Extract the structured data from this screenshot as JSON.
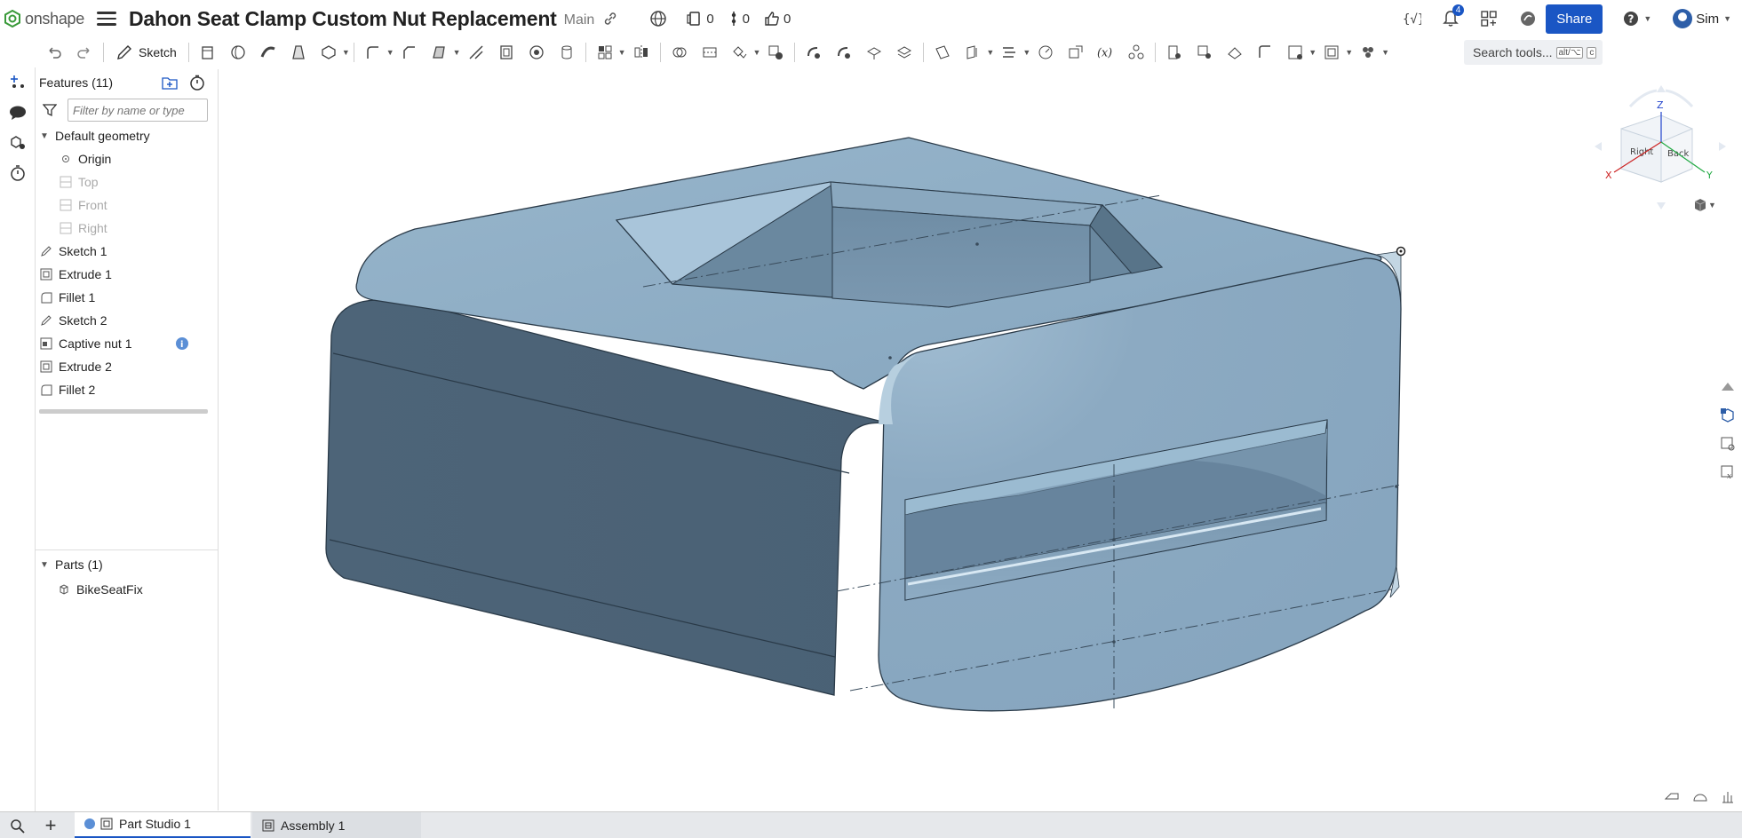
{
  "header": {
    "logo_text": "onshape",
    "doc_title": "Dahon Seat Clamp Custom Nut Replacement",
    "branch": "Main",
    "versions_count": "0",
    "branches_count": "0",
    "likes_count": "0",
    "notifications_count": "4",
    "share_label": "Share",
    "user_name": "Sim",
    "brand_color": "#1a56c4"
  },
  "toolbar": {
    "sketch_label": "Sketch",
    "search_placeholder": "Search tools...",
    "search_shortcut_1": "alt/⌥",
    "search_shortcut_2": "c"
  },
  "features": {
    "header_label": "Features (11)",
    "filter_placeholder": "Filter by name or type",
    "default_geometry_label": "Default geometry",
    "default_items": [
      {
        "label": "Origin",
        "dim": false
      },
      {
        "label": "Top",
        "dim": true
      },
      {
        "label": "Front",
        "dim": true
      },
      {
        "label": "Right",
        "dim": true
      }
    ],
    "items": [
      {
        "label": "Sketch 1",
        "icon": "sketch-icon"
      },
      {
        "label": "Extrude 1",
        "icon": "extrude-icon"
      },
      {
        "label": "Fillet 1",
        "icon": "fillet-icon"
      },
      {
        "label": "Sketch 2",
        "icon": "sketch-icon"
      },
      {
        "label": "Captive nut 1",
        "icon": "custom-feature-icon"
      },
      {
        "label": "Extrude 2",
        "icon": "extrude-icon"
      },
      {
        "label": "Fillet 2",
        "icon": "fillet-icon"
      }
    ]
  },
  "parts": {
    "header_label": "Parts (1)",
    "items": [
      {
        "label": "BikeSeatFix"
      }
    ]
  },
  "viewcube": {
    "z_label": "Z",
    "x_label": "X",
    "y_label": "Y",
    "face_right": "Right",
    "face_back": "Back"
  },
  "tabs": {
    "part_studio": "Part Studio 1",
    "assembly": "Assembly 1"
  }
}
